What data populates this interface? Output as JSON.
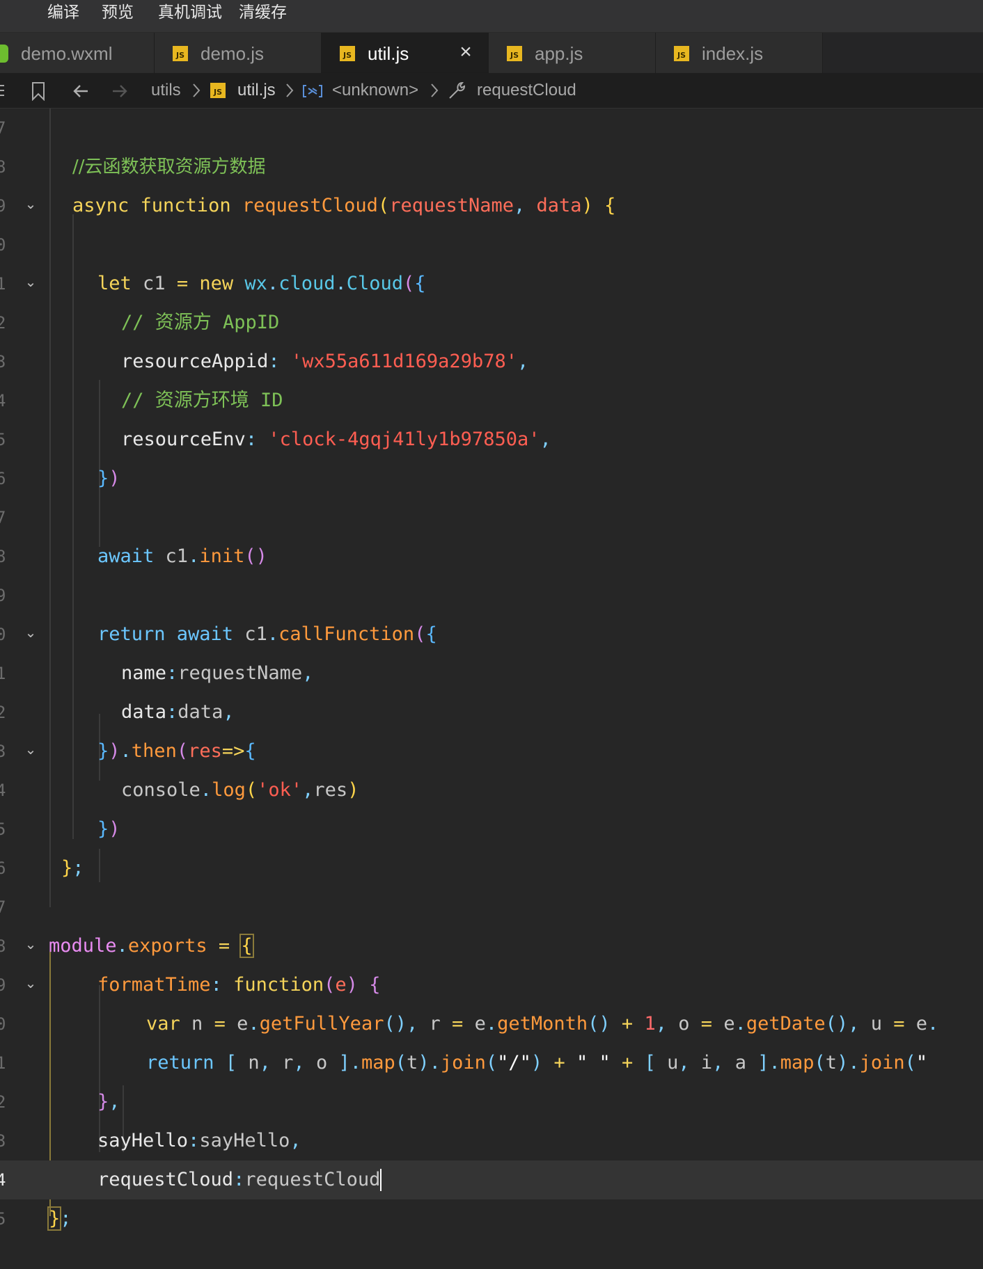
{
  "menu": [
    "编译",
    "预览",
    "真机调试",
    "清缓存"
  ],
  "tabs": [
    {
      "label": "demo.wxml",
      "type": "wxml"
    },
    {
      "label": "demo.js",
      "type": "js"
    },
    {
      "label": "util.js",
      "type": "js",
      "active": true
    },
    {
      "label": "app.js",
      "type": "js"
    },
    {
      "label": "index.js",
      "type": "js"
    }
  ],
  "js_badge_text": "JS",
  "close_glyph": "×",
  "breadcrumb": {
    "folder": "utils",
    "file": "util.js",
    "scope": "<unknown>",
    "function": "requestCloud"
  },
  "gutter": [
    "7",
    "8",
    "9",
    "0",
    "1",
    "2",
    "3",
    "4",
    "5",
    "6",
    "7",
    "8",
    "9",
    "0",
    "1",
    "2",
    "3",
    "4",
    "5",
    "6",
    "7",
    "8",
    "9",
    "0",
    "1",
    "2",
    "3",
    "4",
    "5"
  ],
  "current_line_number": "4",
  "code_lines": [
    "",
    "//云函数获取资源方数据",
    "async function requestCloud(requestName, data) {",
    "",
    "let c1 = new wx.cloud.Cloud({",
    "// 资源方 AppID",
    "resourceAppid: 'wx55a611d169a29b78',",
    "// 资源方环境 ID",
    "resourceEnv: 'clock-4gqj41ly1b97850a',",
    "})",
    "",
    "await c1.init()",
    "",
    "return await c1.callFunction({",
    "name:requestName,",
    "data:data,",
    "}).then(res=>{",
    "console.log('ok',res)",
    "})",
    "};",
    "",
    "module.exports = {",
    "formatTime: function(e) {",
    "var n = e.getFullYear(), r = e.getMonth() + 1, o = e.getDate(), u = e.",
    "return [ n, r, o ].map(t).join(\"/\") + \" \" + [ u, i, a ].map(t).join(\"",
    "},",
    "sayHello:sayHello,",
    "requestCloud:requestCloud",
    "};"
  ],
  "colors": {
    "background": "#262626",
    "comment": "#7ec157",
    "keyword": "#f5d45a",
    "function_name": "#ff9a3d",
    "string": "#ff5e52",
    "js_badge": "#e8b720",
    "wxml_badge": "#6dbd2f"
  },
  "icons": {
    "toolbar": [
      "list-icon",
      "bookmark-icon",
      "back-arrow-icon",
      "forward-arrow-icon"
    ],
    "breadcrumb": [
      "js-file-icon",
      "variable-icon",
      "wrench-icon"
    ]
  }
}
